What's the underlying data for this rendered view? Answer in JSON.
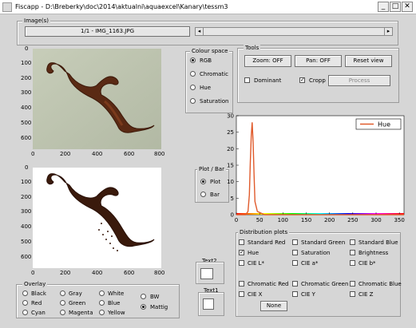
{
  "window": {
    "title": "Fiscapp - D:\\Breberky\\doc\\2014\\aktualni\\aquaexcel\\Kanary\\tessm3",
    "minimize": "_",
    "maximize": "□",
    "close": "✕"
  },
  "images_panel": {
    "legend": "Image(s)",
    "current": "1/1 - IMG_1163.JPG",
    "slider_left": "◂",
    "slider_right": "▸"
  },
  "top_image": {
    "yticks": [
      "0",
      "100",
      "200",
      "300",
      "400",
      "500",
      "600"
    ],
    "xticks": [
      "0",
      "200",
      "400",
      "600",
      "800"
    ]
  },
  "bottom_image": {
    "yticks": [
      "0",
      "100",
      "200",
      "300",
      "400",
      "500",
      "600"
    ],
    "xticks": [
      "0",
      "200",
      "400",
      "600",
      "800"
    ]
  },
  "colour_space": {
    "legend": "Colour space",
    "options": [
      "RGB",
      "Chromatic",
      "Hue",
      "Saturation"
    ],
    "selected": "RGB"
  },
  "tools": {
    "legend": "Tools",
    "zoom": "Zoom: OFF",
    "pan": "Pan: OFF",
    "reset": "Reset view",
    "dominant": "Dominant",
    "cropp": "Cropp",
    "process": "Process"
  },
  "plot_bar": {
    "legend": "Plot / Bar",
    "plot": "Plot",
    "bar": "Bar"
  },
  "chart_data": {
    "type": "line",
    "series": [
      {
        "name": "Hue",
        "color": "#e05a2b",
        "x": [
          0,
          20,
          25,
          28,
          30,
          32,
          34,
          36,
          38,
          40,
          45,
          60,
          100,
          200,
          300,
          360
        ],
        "values": [
          0,
          0,
          1,
          6,
          16,
          24,
          28,
          22,
          12,
          4,
          1,
          0,
          0,
          0,
          0,
          0
        ]
      }
    ],
    "yticks": [
      "0",
      "5",
      "10",
      "15",
      "20",
      "25",
      "30"
    ],
    "xticks": [
      "0",
      "50",
      "100",
      "150",
      "200",
      "250",
      "300",
      "350"
    ],
    "xlim": [
      0,
      360
    ],
    "ylim": [
      0,
      30
    ],
    "legend_position": "top-right"
  },
  "distribution": {
    "legend": "Distribution plots",
    "items": [
      {
        "label": "Standard Red",
        "checked": false
      },
      {
        "label": "Standard Green",
        "checked": false
      },
      {
        "label": "Standard  Blue",
        "checked": false
      },
      {
        "label": "Hue",
        "checked": true
      },
      {
        "label": "Saturation",
        "checked": false
      },
      {
        "label": "Brightness",
        "checked": false
      },
      {
        "label": "CIE L*",
        "checked": false
      },
      {
        "label": "CIE a*",
        "checked": false
      },
      {
        "label": "CIE b*",
        "checked": false
      },
      {
        "label": "Chromatic Red",
        "checked": false
      },
      {
        "label": "Chromatic Green",
        "checked": false
      },
      {
        "label": "Chromatic Blue",
        "checked": false
      },
      {
        "label": "CIE X",
        "checked": false
      },
      {
        "label": "CIE Y",
        "checked": false
      },
      {
        "label": "CIE Z",
        "checked": false
      }
    ],
    "none": "None"
  },
  "text2": {
    "label": "Text2"
  },
  "text1": {
    "label": "Text1"
  },
  "overlay": {
    "legend": "Overlay",
    "options": [
      "Black",
      "Gray",
      "White",
      "Red",
      "Green",
      "Blue",
      "Cyan",
      "Magenta",
      "Yellow"
    ],
    "bw": "BW",
    "mattig": "Mattig",
    "selected": "Mattig"
  },
  "colors": {
    "accent": "#e05a2b",
    "background": "#d6d6d6"
  }
}
